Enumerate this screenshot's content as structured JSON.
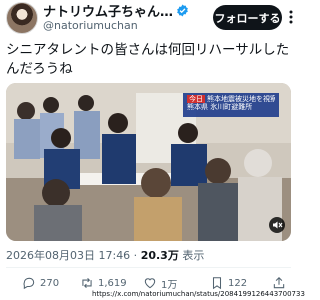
{
  "header": {
    "display_name": "ナトリウム子ちゃん…",
    "handle": "@natoriumuchan",
    "follow_label": "フォローする"
  },
  "tweet": {
    "text": "シニアタレントの皆さんは何回リハーサルしたんだろうね"
  },
  "media": {
    "caption_tag": "今日",
    "caption_line1": "熊本地震被災地を視察",
    "caption_line2": "熊本県 氷川町避難所"
  },
  "meta": {
    "timestamp": "2026年08月03日 17:46 · ",
    "views_count": "20.3万",
    "views_label": " 表示"
  },
  "actions": {
    "reply_count": "270",
    "retweet_count": "1,619",
    "like_count": "1万",
    "bookmark_count": "122"
  },
  "overlay": {
    "url": "https://x.com/natoriumuchan/status/2084199126443700733"
  },
  "colors": {
    "accent": "#1d9bf0",
    "text": "#0f1419",
    "muted": "#536471",
    "follow_bg": "#0f1419"
  }
}
